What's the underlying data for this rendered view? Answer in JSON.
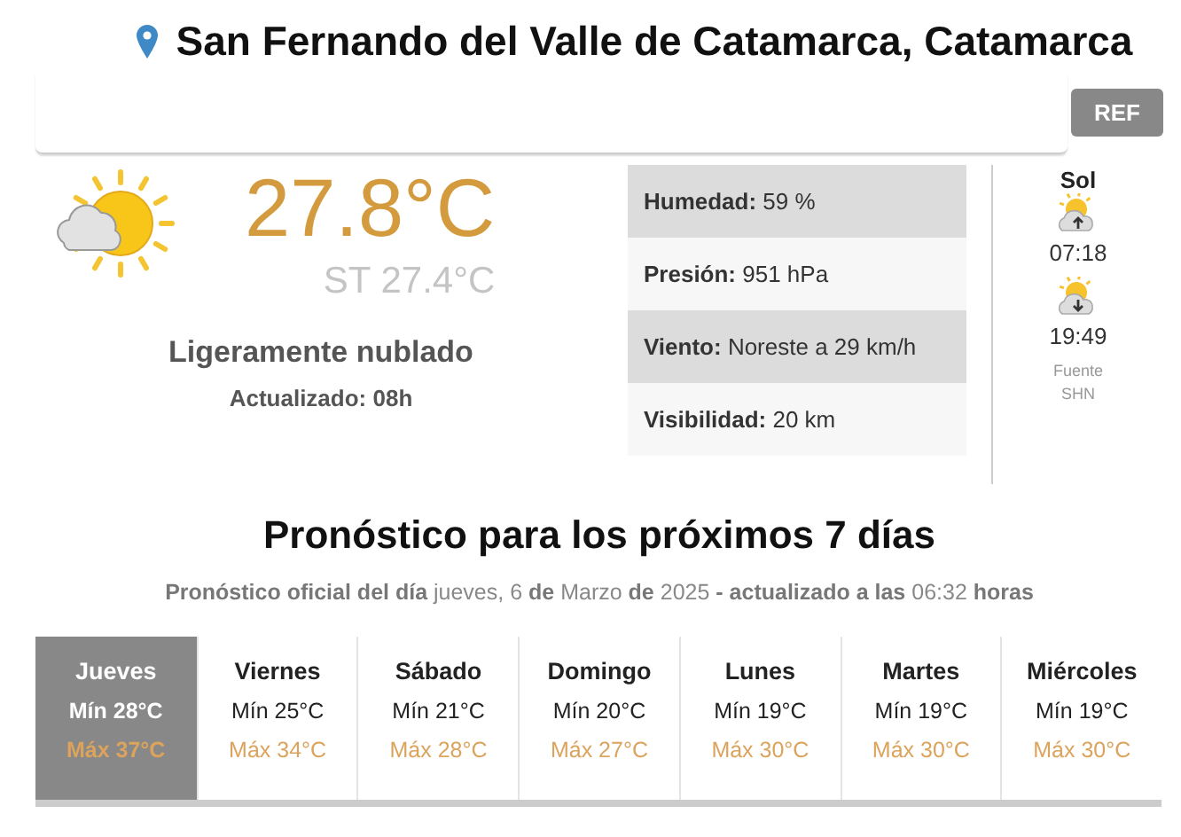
{
  "location": {
    "title": "San Fernando del Valle de Catamarca, Catamarca"
  },
  "ref_button": "REF",
  "current": {
    "temperature": "27.8°C",
    "feels_like": "ST 27.4°C",
    "condition": "Ligeramente nublado",
    "updated": "Actualizado: 08h"
  },
  "details": [
    {
      "text": "**Humedad:** 59 %",
      "shaded": true
    },
    {
      "text": "**Presión:** 951 hPa",
      "shaded": false
    },
    {
      "text": "**Viento:** Noreste a 29 km/h",
      "shaded": true
    },
    {
      "text": "**Visibilidad:** 20 km",
      "shaded": false
    }
  ],
  "sun": {
    "title": "Sol",
    "events": [
      {
        "kind": "sunrise",
        "time": "07:18"
      },
      {
        "kind": "sunset",
        "time": "19:49"
      }
    ],
    "source": [
      "Fuente",
      "SHN"
    ]
  },
  "forecast": {
    "title": "Pronóstico para los próximos 7 días",
    "subtitle": "**Pronóstico oficial del día** jueves, 6 **de** Marzo **de** 2025 **- actualizado a las** 06:32 **horas**",
    "days": [
      {
        "day": "Jueves",
        "min": "Mín 28°C",
        "max": "Máx 37°C",
        "selected": true
      },
      {
        "day": "Viernes",
        "min": "Mín 25°C",
        "max": "Máx 34°C",
        "selected": false
      },
      {
        "day": "Sábado",
        "min": "Mín 21°C",
        "max": "Máx 28°C",
        "selected": false
      },
      {
        "day": "Domingo",
        "min": "Mín 20°C",
        "max": "Máx 27°C",
        "selected": false
      },
      {
        "day": "Lunes",
        "min": "Mín 19°C",
        "max": "Máx 30°C",
        "selected": false
      },
      {
        "day": "Martes",
        "min": "Mín 19°C",
        "max": "Máx 30°C",
        "selected": false
      },
      {
        "day": "Miércoles",
        "min": "Mín 19°C",
        "max": "Máx 30°C",
        "selected": false
      }
    ]
  }
}
